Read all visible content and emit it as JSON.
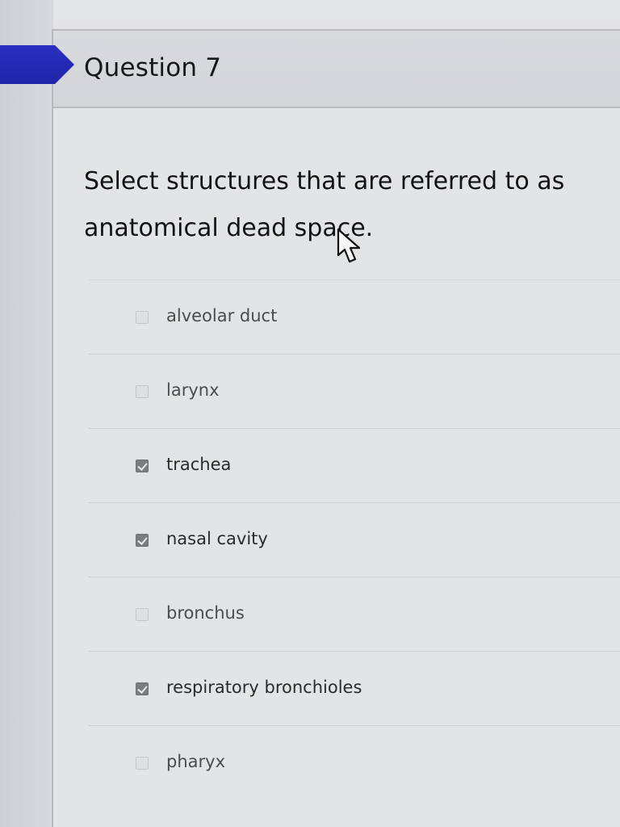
{
  "question": {
    "title": "Question 7",
    "prompt_line1": "Select structures that are referred to as",
    "prompt_line2": "anatomical dead space."
  },
  "options": [
    {
      "label": "alveolar duct",
      "checked": false
    },
    {
      "label": "larynx",
      "checked": false
    },
    {
      "label": "trachea",
      "checked": true
    },
    {
      "label": "nasal cavity",
      "checked": true
    },
    {
      "label": "bronchus",
      "checked": false
    },
    {
      "label": "respiratory bronchioles",
      "checked": true
    },
    {
      "label": "pharyx",
      "checked": false
    }
  ],
  "colors": {
    "flag": "#2a2fc0",
    "checked_box": "#7a7c80"
  },
  "icons": {
    "cursor": "mouse-pointer-icon"
  }
}
